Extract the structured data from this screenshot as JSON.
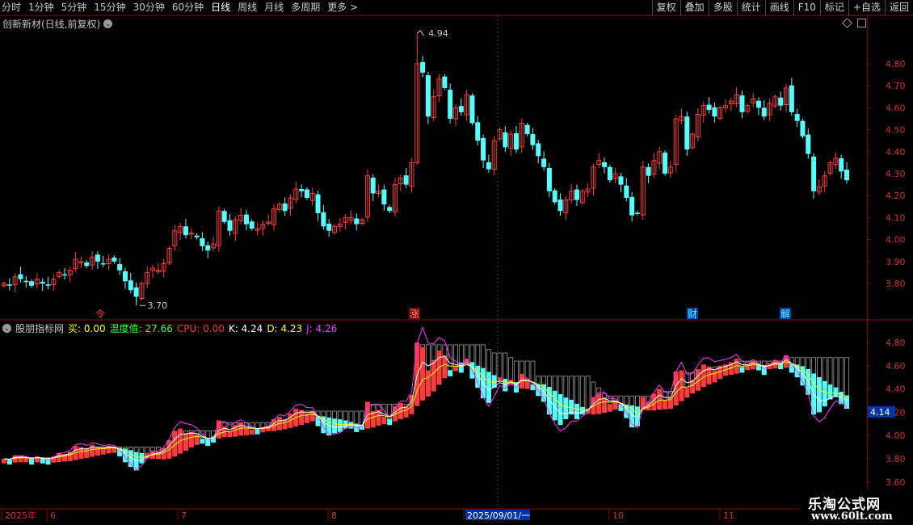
{
  "toolbar": {
    "periods": [
      "分时",
      "1分钟",
      "5分钟",
      "15分钟",
      "30分钟",
      "60分钟",
      "日线",
      "周线",
      "月线",
      "多周期",
      "更多 >"
    ],
    "active_period": "日线",
    "right_buttons": [
      "复权",
      "叠加",
      "多股",
      "统计",
      "画线",
      "F10",
      "标记",
      "+自选",
      "返回"
    ]
  },
  "main_chart": {
    "title": "创新新材(日线,前复权)",
    "y_ticks": [
      "4.80",
      "4.70",
      "4.60",
      "4.50",
      "4.40",
      "4.30",
      "4.20",
      "4.10",
      "4.00",
      "3.90",
      "3.80"
    ],
    "high_label": "4.94",
    "low_label": "3.70",
    "event_tags": [
      "令",
      "涨",
      "财",
      "解"
    ]
  },
  "indicator": {
    "name": "股朋指标网",
    "buy_label": "买:",
    "buy_value": "0.00",
    "temp_label": "温度值:",
    "temp_value": "27.66",
    "cpu_label": "CPU:",
    "cpu_value": "0.00",
    "k_label": "K:",
    "k_value": "4.24",
    "d_label": "D:",
    "d_value": "4.23",
    "j_label": "J:",
    "j_value": "4.26",
    "y_ticks": [
      "4.80",
      "4.60",
      "4.40",
      "4.20",
      "4.00",
      "3.80",
      "3.60"
    ],
    "current_value": "4.14"
  },
  "x_axis": {
    "labels": [
      "2025年",
      "6",
      "7",
      "8",
      "2025/09/01/一",
      "10",
      "11"
    ]
  },
  "watermark": {
    "line1": "乐淘公式网",
    "line2": "www.60lt.com"
  },
  "colors": {
    "up": "#ff3b3b",
    "down": "#54ffff",
    "panel_border": "#8b0000",
    "k_line": "#ffffff",
    "d_line": "#ffff00",
    "j_line": "#ff33ff"
  },
  "chart_data": {
    "type": "candlestick",
    "close": [
      3.8,
      3.79,
      3.83,
      3.82,
      3.81,
      3.79,
      3.82,
      3.8,
      3.79,
      3.82,
      3.85,
      3.84,
      3.86,
      3.91,
      3.9,
      3.88,
      3.92,
      3.9,
      3.89,
      3.91,
      3.9,
      3.86,
      3.81,
      3.77,
      3.74,
      3.8,
      3.85,
      3.87,
      3.86,
      3.89,
      3.96,
      4.04,
      4.06,
      4.02,
      4.03,
      4.01,
      3.97,
      3.95,
      3.98,
      4.13,
      4.08,
      4.04,
      4.09,
      4.11,
      4.07,
      4.05,
      4.05,
      4.07,
      4.08,
      4.14,
      4.16,
      4.13,
      4.19,
      4.23,
      4.22,
      4.19,
      4.21,
      4.12,
      4.06,
      4.04,
      4.06,
      4.07,
      4.1,
      4.1,
      4.07,
      4.09,
      4.29,
      4.21,
      4.22,
      4.16,
      4.13,
      4.25,
      4.28,
      4.25,
      4.35,
      4.8,
      4.76,
      4.56,
      4.65,
      4.73,
      4.69,
      4.55,
      4.6,
      4.58,
      4.66,
      4.53,
      4.45,
      4.36,
      4.32,
      4.45,
      4.5,
      4.42,
      4.48,
      4.41,
      4.53,
      4.48,
      4.43,
      4.38,
      4.33,
      4.22,
      4.17,
      4.13,
      4.18,
      4.22,
      4.18,
      4.22,
      4.23,
      4.33,
      4.36,
      4.33,
      4.27,
      4.3,
      4.25,
      4.19,
      4.11,
      4.12,
      4.33,
      4.29,
      4.36,
      4.4,
      4.3,
      4.33,
      4.55,
      4.56,
      4.41,
      4.48,
      4.57,
      4.61,
      4.59,
      4.56,
      4.6,
      4.61,
      4.63,
      4.66,
      4.58,
      4.61,
      4.64,
      4.6,
      4.56,
      4.62,
      4.65,
      4.61,
      4.69,
      4.58,
      4.54,
      4.47,
      4.39,
      4.22,
      4.24,
      4.29,
      4.35,
      4.37,
      4.31,
      4.27
    ],
    "ylim": [
      3.7,
      4.94
    ]
  }
}
